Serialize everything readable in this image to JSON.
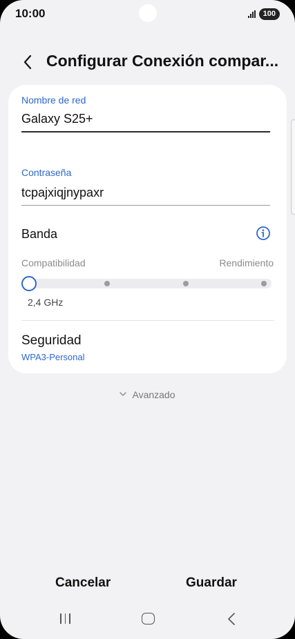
{
  "status_bar": {
    "time": "10:00",
    "battery": "100"
  },
  "header": {
    "title": "Configurar Conexión compar..."
  },
  "form": {
    "network_name": {
      "label": "Nombre de red",
      "value": "Galaxy S25+"
    },
    "password": {
      "label": "Contraseña",
      "value": "tcpajxiqjnypaxr"
    },
    "band": {
      "label": "Banda",
      "left_caption": "Compatibilidad",
      "right_caption": "Rendimiento",
      "selected": "2,4 GHz",
      "selected_step": 1,
      "steps": 4
    },
    "security": {
      "label": "Seguridad",
      "value": "WPA3-Personal"
    }
  },
  "advanced_label": "Avanzado",
  "actions": {
    "cancel": "Cancelar",
    "save": "Guardar"
  },
  "colors": {
    "accent": "#2d67c9",
    "background": "#f2f2f4",
    "card": "#ffffff"
  },
  "icons": {
    "back": "chevron-left-icon",
    "info": "info-icon",
    "advanced": "chevron-down-icon",
    "nav_recents": "recents-icon",
    "nav_home": "home-icon",
    "nav_back": "back-icon"
  }
}
